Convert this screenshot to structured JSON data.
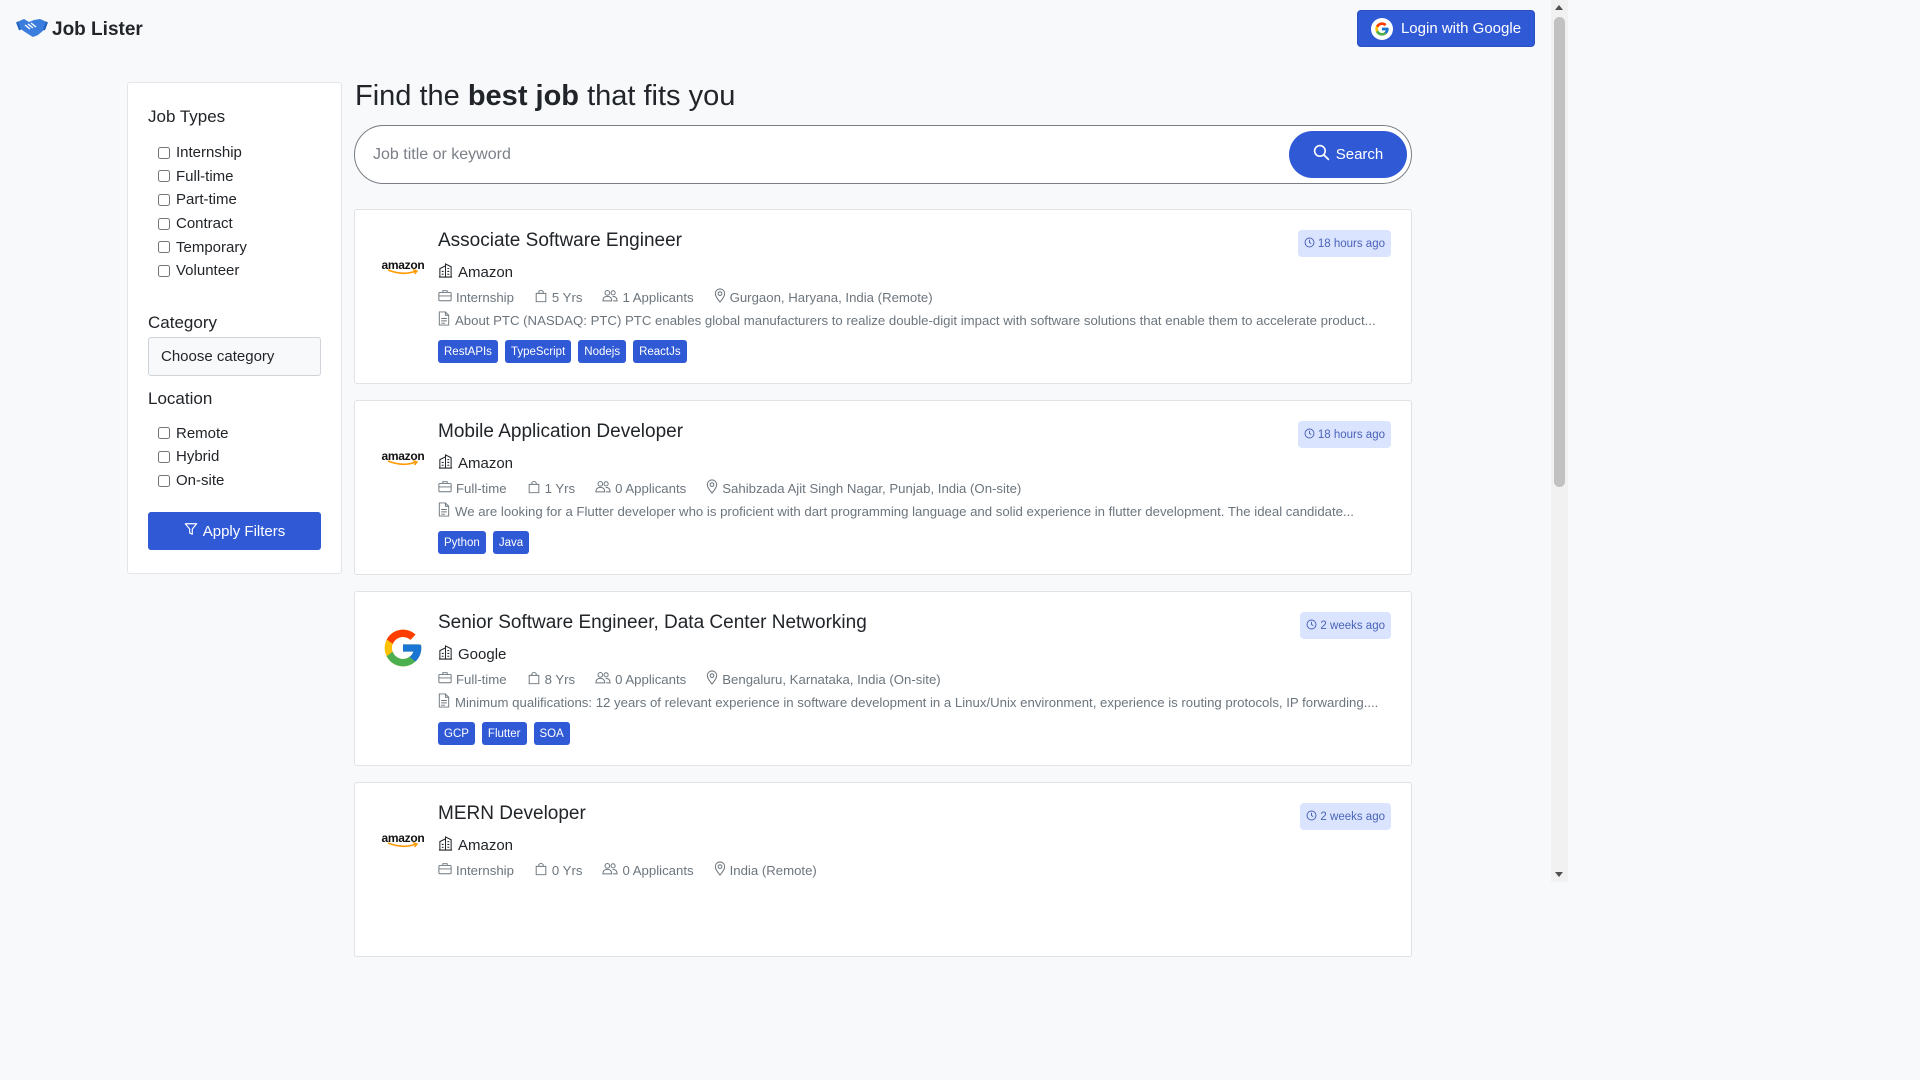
{
  "brand": {
    "name": "Job Lister",
    "icon": "handshake-icon"
  },
  "header": {
    "login_label": "Login with Google"
  },
  "sidebar": {
    "job_types_title": "Job Types",
    "job_types": [
      "Internship",
      "Full-time",
      "Part-time",
      "Contract",
      "Temporary",
      "Volunteer"
    ],
    "category_title": "Category",
    "category_value": "Choose category",
    "location_title": "Location",
    "locations": [
      "Remote",
      "Hybrid",
      "On-site"
    ],
    "apply_label": "Apply Filters"
  },
  "hero": {
    "prefix": "Find the ",
    "bold": "best job",
    "suffix": " that fits you"
  },
  "search": {
    "placeholder": "Job title or keyword",
    "button_label": "Search"
  },
  "colors": {
    "accent": "#3059d6",
    "badge_bg": "#dbe4ff",
    "page_bg": "#f8f9fa"
  },
  "jobs": [
    {
      "title": "Associate Software Engineer",
      "company": "Amazon",
      "logo": "amazon",
      "time": "18 hours ago",
      "type": "Internship",
      "experience": "5 Yrs",
      "applicants": "1 Applicants",
      "location": "Gurgaon, Haryana, India (Remote)",
      "description": "About PTC (NASDAQ: PTC) PTC enables global manufacturers to realize double-digit impact with software solutions that enable them to accelerate product...",
      "tags": [
        "RestAPIs",
        "TypeScript",
        "Nodejs",
        "ReactJs"
      ]
    },
    {
      "title": "Mobile Application Developer",
      "company": "Amazon",
      "logo": "amazon",
      "time": "18 hours ago",
      "type": "Full-time",
      "experience": "1 Yrs",
      "applicants": "0 Applicants",
      "location": "Sahibzada Ajit Singh Nagar, Punjab, India (On-site)",
      "description": "We are looking for a Flutter developer who is proficient with dart programming language and solid experience in flutter development. The ideal candidate...",
      "tags": [
        "Python",
        "Java"
      ]
    },
    {
      "title": "Senior Software Engineer, Data Center Networking",
      "company": "Google",
      "logo": "google",
      "time": "2 weeks ago",
      "type": "Full-time",
      "experience": "8 Yrs",
      "applicants": "0 Applicants",
      "location": "Bengaluru, Karnataka, India (On-site)",
      "description": "Minimum qualifications: 12 years of relevant experience in software development in a Linux/Unix environment, experience is routing protocols, IP forwarding....",
      "tags": [
        "GCP",
        "Flutter",
        "SOA"
      ]
    },
    {
      "title": "MERN Developer",
      "company": "Amazon",
      "logo": "amazon",
      "time": "2 weeks ago",
      "type": "Internship",
      "experience": "0 Yrs",
      "applicants": "0 Applicants",
      "location": "India (Remote)",
      "description": "",
      "tags": []
    }
  ]
}
